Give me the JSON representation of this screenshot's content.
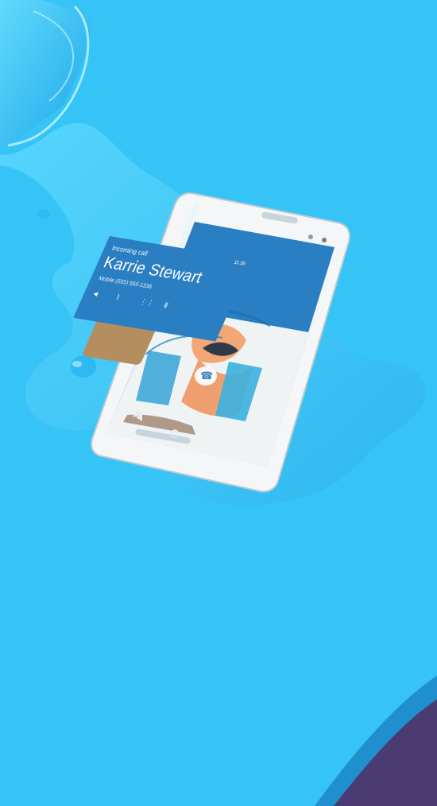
{
  "call_screen": {
    "status": "Incoming call",
    "caller_name": "Karrie Stewart",
    "caller_number": "Mobile (555) 555-1336",
    "clock": "11:35",
    "icons": [
      "speaker-icon",
      "mute-icon",
      "dialpad-icon",
      "hold-icon"
    ],
    "answer_icon": "phone-icon"
  },
  "navigation": {
    "back_icon": "back-triangle-icon",
    "home_icon": "home-circle-icon"
  },
  "colors": {
    "background": "#36c3f6",
    "water": "#49cdfb",
    "accent_blue": "#2a7fc3",
    "phone_white": "#f4f6f8",
    "corner_purple": "#4b3b73"
  }
}
